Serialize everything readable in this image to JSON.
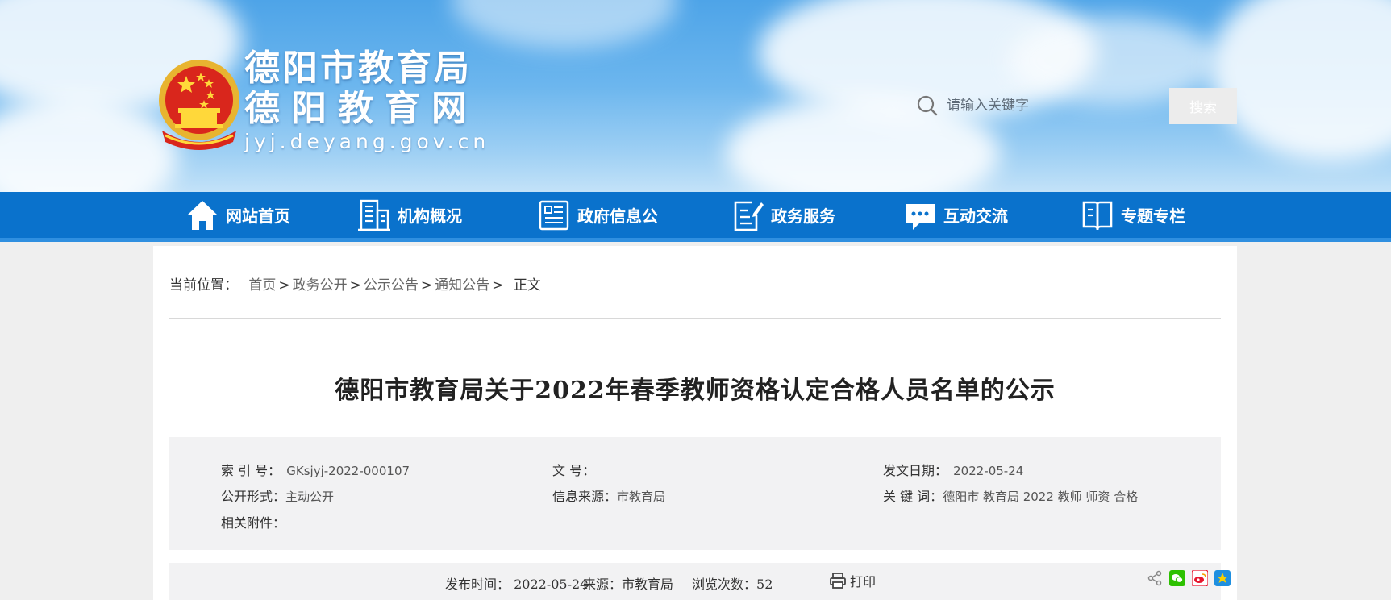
{
  "header": {
    "site_name_line1": "德阳市教育局",
    "site_name_line2": "德阳教育网",
    "site_domain": "jyj.deyang.gov.cn",
    "search_placeholder": "请输入关键字",
    "search_button": "搜索"
  },
  "nav": {
    "items": [
      {
        "label": "网站首页",
        "icon": "home-icon"
      },
      {
        "label": "机构概况",
        "icon": "building-icon"
      },
      {
        "label": "政府信息公",
        "icon": "document-list-icon"
      },
      {
        "label": "政务服务",
        "icon": "edit-document-icon"
      },
      {
        "label": "互动交流",
        "icon": "chat-bubble-icon"
      },
      {
        "label": "专题专栏",
        "icon": "open-book-icon"
      }
    ]
  },
  "breadcrumb": {
    "prefix": "当前位置：",
    "items": [
      "首页",
      "政务公开",
      "公示公告",
      "通知公告"
    ],
    "separator": ">",
    "current": "正文"
  },
  "article": {
    "title": "德阳市教育局关于2022年春季教师资格认定合格人员名单的公示"
  },
  "meta": {
    "index_label": "索 引 号：",
    "index_value": "GKsjyj-2022-000107",
    "doc_no_label": "文 号：",
    "doc_no_value": "",
    "issue_date_label": "发文日期：",
    "issue_date_value": "2022-05-24",
    "public_form_label": "公开形式：",
    "public_form_value": "主动公开",
    "info_source_label": "信息来源：",
    "info_source_value": "市教育局",
    "keywords_label": "关 键 词：",
    "keywords_value": "德阳市 教育局 2022 教师 师资 合格",
    "attachments_label": "相关附件："
  },
  "info_bar": {
    "publish_time_label": "发布时间：",
    "publish_time_value": "2022-05-24",
    "source_label": "来源：",
    "source_value": "市教育局",
    "views_label": "浏览次数：",
    "views_value": "52",
    "print_label": "打印"
  },
  "colors": {
    "nav_blue": "#0a72cc",
    "wechat_green": "#2dc100",
    "weibo_red": "#e6162d",
    "qzone_yellow": "#f8b500"
  }
}
